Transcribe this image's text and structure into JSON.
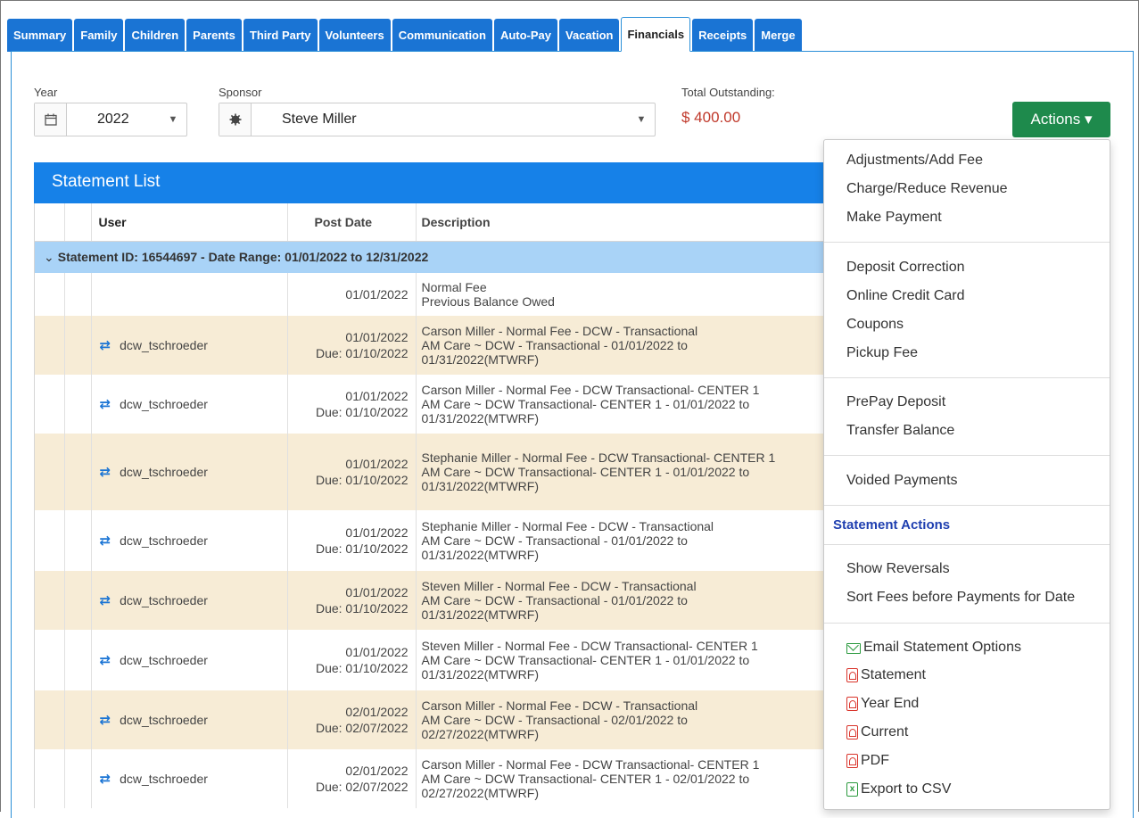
{
  "tabs": [
    {
      "label": "Summary"
    },
    {
      "label": "Family"
    },
    {
      "label": "Children"
    },
    {
      "label": "Parents"
    },
    {
      "label": "Third Party"
    },
    {
      "label": "Volunteers"
    },
    {
      "label": "Communication"
    },
    {
      "label": "Auto-Pay"
    },
    {
      "label": "Vacation"
    },
    {
      "label": "Financials",
      "active": true
    },
    {
      "label": "Receipts"
    },
    {
      "label": "Merge"
    }
  ],
  "filters": {
    "year_label": "Year",
    "year_value": "2022",
    "sponsor_label": "Sponsor",
    "sponsor_value": "Steve Miller",
    "outstanding_label": "Total Outstanding:",
    "outstanding_value": "$ 400.00"
  },
  "actions": {
    "button_label": "Actions ▾",
    "items": [
      {
        "label": "Adjustments/Add Fee"
      },
      {
        "label": "Charge/Reduce Revenue"
      },
      {
        "label": "Make Payment"
      },
      {
        "label": "Deposit Correction"
      },
      {
        "label": "Online Credit Card"
      },
      {
        "label": "Coupons"
      },
      {
        "label": "Pickup Fee"
      },
      {
        "label": "PrePay Deposit"
      },
      {
        "label": "Transfer Balance"
      },
      {
        "label": "Voided Payments"
      },
      {
        "label": "Show Reversals"
      },
      {
        "label": "Sort Fees before Payments for Date"
      },
      {
        "label": "Email Statement Options",
        "icon": "envelope-icon"
      },
      {
        "label": "Statement",
        "icon": "pdf-icon"
      },
      {
        "label": "Year End",
        "icon": "pdf-icon"
      },
      {
        "label": "Current",
        "icon": "pdf-icon"
      },
      {
        "label": "PDF",
        "icon": "pdf-icon"
      },
      {
        "label": "Export to CSV",
        "icon": "csv-icon"
      }
    ],
    "section_heading": "Statement Actions"
  },
  "statement_list": {
    "title": "Statement List",
    "columns": {
      "user": "User",
      "post_date": "Post Date",
      "description": "Description"
    },
    "group_label": "Statement ID: 16544697 - Date Range: 01/01/2022 to 12/31/2022",
    "rows": [
      {
        "user": "",
        "date": "01/01/2022",
        "due": "",
        "desc1": "Normal Fee",
        "desc2": "Previous Balance Owed",
        "desc3": ""
      },
      {
        "user": "dcw_tschroeder",
        "date": "01/01/2022",
        "due": "Due: 01/10/2022",
        "desc1": "Carson Miller - Normal Fee - DCW - Transactional",
        "desc2": "AM Care ~ DCW - Transactional - 01/01/2022 to",
        "desc3": "01/31/2022(MTWRF)"
      },
      {
        "user": "dcw_tschroeder",
        "date": "01/01/2022",
        "due": "Due: 01/10/2022",
        "desc1": "Carson Miller - Normal Fee - DCW Transactional- CENTER 1",
        "desc2": "AM Care ~ DCW Transactional- CENTER 1 - 01/01/2022 to",
        "desc3": "01/31/2022(MTWRF)"
      },
      {
        "user": "dcw_tschroeder",
        "date": "01/01/2022",
        "due": "Due: 01/10/2022",
        "desc1": "Stephanie Miller - Normal Fee - DCW Transactional- CENTER 1",
        "desc2": "AM Care ~ DCW Transactional- CENTER 1 - 01/01/2022 to",
        "desc3": "01/31/2022(MTWRF)"
      },
      {
        "user": "dcw_tschroeder",
        "date": "01/01/2022",
        "due": "Due: 01/10/2022",
        "desc1": "Stephanie Miller - Normal Fee - DCW - Transactional",
        "desc2": "AM Care ~ DCW - Transactional - 01/01/2022 to",
        "desc3": "01/31/2022(MTWRF)"
      },
      {
        "user": "dcw_tschroeder",
        "date": "01/01/2022",
        "due": "Due: 01/10/2022",
        "desc1": "Steven Miller - Normal Fee - DCW - Transactional",
        "desc2": "AM Care ~ DCW - Transactional - 01/01/2022 to",
        "desc3": "01/31/2022(MTWRF)"
      },
      {
        "user": "dcw_tschroeder",
        "date": "01/01/2022",
        "due": "Due: 01/10/2022",
        "desc1": "Steven Miller - Normal Fee - DCW Transactional- CENTER 1",
        "desc2": "AM Care ~ DCW Transactional- CENTER 1 - 01/01/2022 to",
        "desc3": "01/31/2022(MTWRF)"
      },
      {
        "user": "dcw_tschroeder",
        "date": "02/01/2022",
        "due": "Due: 02/07/2022",
        "desc1": "Carson Miller - Normal Fee - DCW - Transactional",
        "desc2": "AM Care ~ DCW - Transactional - 02/01/2022 to",
        "desc3": "02/27/2022(MTWRF)"
      },
      {
        "user": "dcw_tschroeder",
        "date": "02/01/2022",
        "due": "Due: 02/07/2022",
        "desc1": "Carson Miller - Normal Fee - DCW Transactional- CENTER 1",
        "desc2": "AM Care ~ DCW Transactional- CENTER 1 - 02/01/2022 to",
        "desc3": "02/27/2022(MTWRF)"
      }
    ]
  },
  "colors": {
    "tab_blue": "#1a74d4",
    "header_blue": "#1681e8",
    "group_row": "#a9d3f7",
    "tan_row": "#f7ecd6",
    "actions_green": "#1e8a4c",
    "outstanding_red": "#c0392b",
    "heading_blue": "#1f3fb0"
  }
}
